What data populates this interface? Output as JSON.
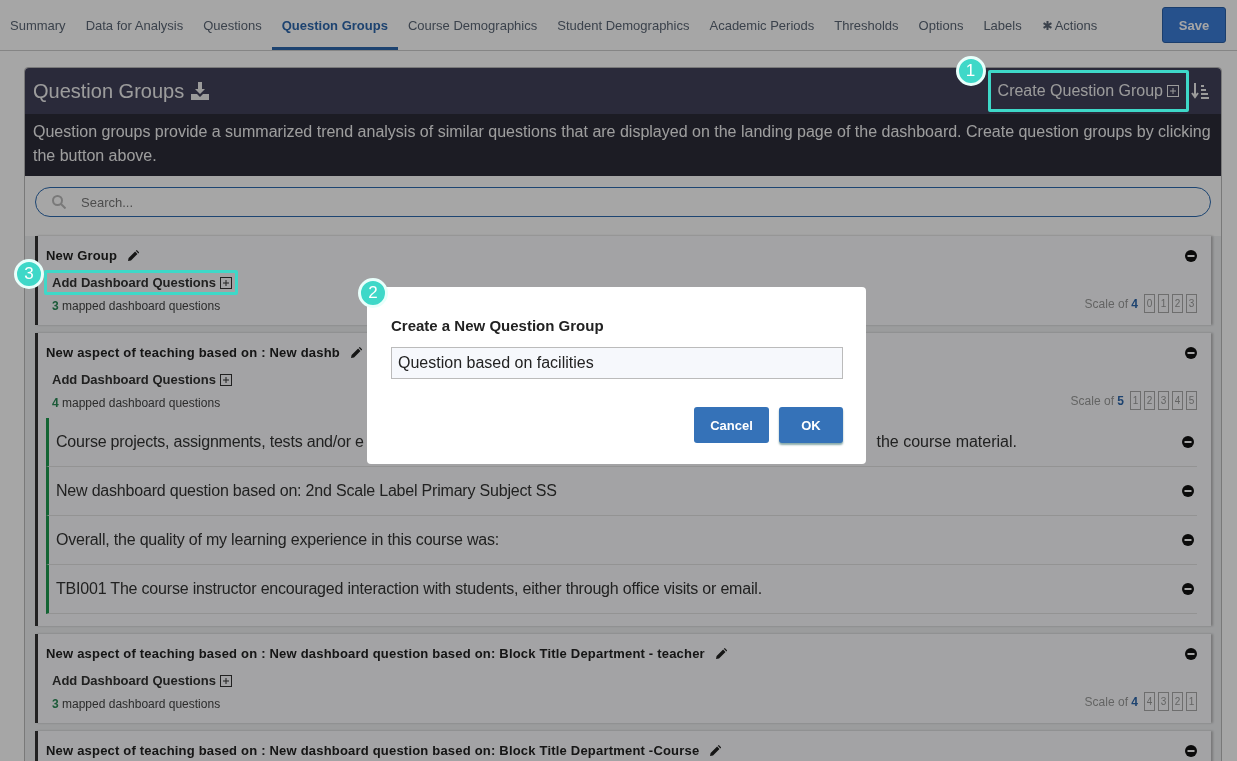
{
  "tabs": [
    {
      "kind": "text",
      "label": "Summary",
      "selected": false
    },
    {
      "kind": "text",
      "label": "Data for Analysis",
      "selected": false
    },
    {
      "kind": "text",
      "label": "Questions",
      "selected": false
    },
    {
      "kind": "text",
      "label": "Question Groups",
      "selected": true
    },
    {
      "kind": "text",
      "label": "Course Demographics",
      "selected": false
    },
    {
      "kind": "text",
      "label": "Student Demographics",
      "selected": false
    },
    {
      "kind": "text",
      "label": "Academic Periods",
      "selected": false
    },
    {
      "kind": "text",
      "label": "Thresholds",
      "selected": false
    },
    {
      "kind": "text",
      "label": "Options",
      "selected": false
    },
    {
      "kind": "text",
      "label": "Labels",
      "selected": false
    },
    {
      "kind": "icon",
      "label": "Actions",
      "selected": false
    }
  ],
  "save_button": "Save",
  "panel": {
    "title": "Question Groups",
    "create_button": {
      "label": "Create Question Group",
      "callout": "1"
    },
    "description": "Question groups provide a summarized trend analysis of similar questions that are displayed on the landing page of the dashboard. Create question groups by clicking the button above.",
    "search": {
      "placeholder": "Search..."
    }
  },
  "groups": [
    {
      "title": "New Group",
      "add_button": {
        "label": "Add Dashboard Questions",
        "callout": "3"
      },
      "mapped_count": "3",
      "mapped_text": "mapped dashboard questions",
      "scale_label": "Scale of",
      "scale_count": "4",
      "scale_points": [
        "0",
        "1",
        "2",
        "3"
      ]
    },
    {
      "title": "New aspect of teaching based on : New dashb",
      "add_button": {
        "label": "Add Dashboard Questions"
      },
      "mapped_count": "4",
      "mapped_text": "mapped dashboard questions",
      "scale_label": "Scale of",
      "scale_count": "5",
      "scale_points": [
        "1",
        "2",
        "3",
        "4",
        "5"
      ],
      "questions": [
        {
          "text": "Course projects, assignments, tests and/or e",
          "tail": "the course material."
        },
        {
          "text": "New dashboard question based on: 2nd Scale Label Primary Subject SS"
        },
        {
          "text": "Overall, the quality of my learning experience in this course was:"
        },
        {
          "text": "TBI001 The course instructor encouraged interaction with students, either through office visits or email."
        }
      ]
    },
    {
      "title": "New aspect of teaching based on : New dashboard question based on: Block Title Department - teacher",
      "add_button": {
        "label": "Add Dashboard Questions"
      },
      "mapped_count": "3",
      "mapped_text": "mapped dashboard questions",
      "scale_label": "Scale of",
      "scale_count": "4",
      "scale_points": [
        "4",
        "3",
        "2",
        "1"
      ]
    },
    {
      "title": "New aspect of teaching based on : New dashboard question based on: Block Title Department -Course"
    }
  ],
  "dialog": {
    "title": "Create a New Question Group",
    "value": "Question based on facilities",
    "callout": "2",
    "buttons": [
      {
        "kind": "secondary",
        "label": "Cancel"
      },
      {
        "kind": "primary",
        "label": "OK"
      }
    ]
  }
}
